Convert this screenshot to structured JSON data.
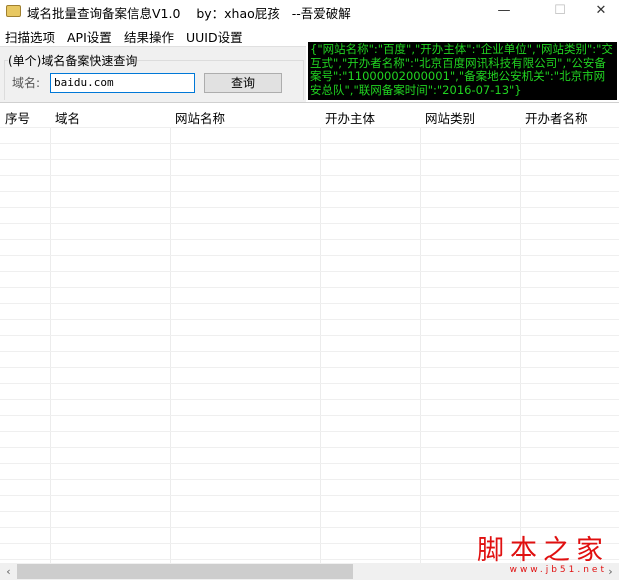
{
  "window": {
    "title": "域名批量查询备案信息V1.0    by：xhao屁孩   --吾爱破解",
    "minimize": "—",
    "maximize": "☐",
    "close": "✕"
  },
  "menu": [
    "扫描选项",
    "API设置",
    "结果操作",
    "UUID设置"
  ],
  "quick_query": {
    "group_label": "(单个)域名备案快速查询",
    "field_label": "域名:",
    "domain_value": "baidu.com",
    "button": "查询"
  },
  "console_output": "{\"网站名称\":\"百度\",\"开办主体\":\"企业单位\",\"网站类别\":\"交互式\",\"开办者名称\":\"北京百度网讯科技有限公司\",\"公安备案号\":\"11000002000001\",\"备案地公安机关\":\"北京市网安总队\",\"联网备案时间\":\"2016-07-13\"}",
  "table": {
    "columns": [
      "序号",
      "域名",
      "网站名称",
      "开办主体",
      "网站类别",
      "开办者名称"
    ],
    "rows": []
  },
  "scrollbar": {
    "left": "‹",
    "right": "›"
  },
  "watermark": {
    "text": "脚本之家",
    "url": "www.jb51.net"
  }
}
